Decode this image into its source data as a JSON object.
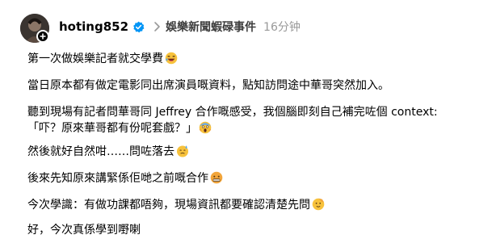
{
  "post": {
    "username": "hoting852",
    "topic": "娛樂新聞蝦碌事件",
    "time": "16分钟",
    "paragraphs": [
      {
        "text": "第一次做娛樂記者就交學費",
        "emoji": "rolling-laugh-emoji"
      },
      {
        "text": "當日原本都有做定電影同出席演員嘅資料，點知訪問途中華哥突然加入。",
        "emoji": null
      },
      {
        "text": "聽到現場有記者問華哥同 Jeffrey 合作嘅感受，我個腦即刻自己補完咗個 context:",
        "emoji": null
      },
      {
        "text": "「吓？原來華哥都有份呢套戲？」",
        "emoji": "screaming-emoji"
      },
      {
        "text": "然後就好自然咁……問咗落去",
        "emoji": "sweat-emoji"
      },
      {
        "text": "後來先知原來講緊係佢哋之前嘅合作",
        "emoji": "sweating-face-emoji"
      },
      {
        "text": "今次學識：有做功課都唔夠，現場資訊都要確認清楚先問",
        "emoji": "saluting-face-emoji"
      },
      {
        "text": "好，今次真係學到嘢喇",
        "emoji": null
      }
    ]
  },
  "colors": {
    "verified_blue": "#0095f6",
    "muted_text": "#999999",
    "topic_text": "#3d3d3d"
  }
}
